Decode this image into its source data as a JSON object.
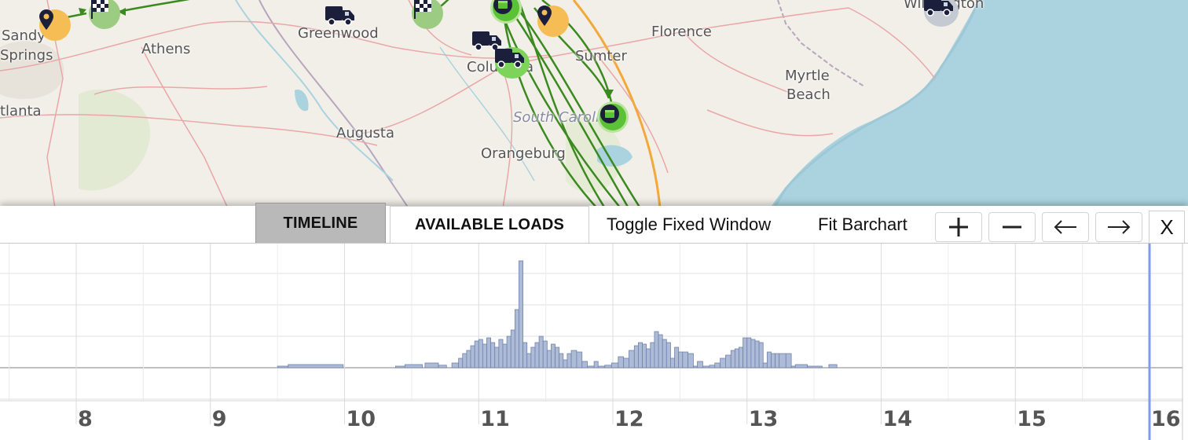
{
  "map": {
    "places": [
      {
        "name": "Sandy",
        "cls": "",
        "x": 2,
        "y": 36
      },
      {
        "name": "Springs",
        "cls": "",
        "x": 0,
        "y": 61
      },
      {
        "name": "Athens",
        "cls": "",
        "x": 180,
        "y": 53
      },
      {
        "name": "tlanta",
        "cls": "",
        "x": 0,
        "y": 132
      },
      {
        "name": "Greenwood",
        "cls": "",
        "x": 379,
        "y": 33
      },
      {
        "name": "Columbia",
        "cls": "",
        "x": 594,
        "y": 76
      },
      {
        "name": "Sumter",
        "cls": "",
        "x": 732,
        "y": 62
      },
      {
        "name": "Florence",
        "cls": "",
        "x": 829,
        "y": 31
      },
      {
        "name": "Myrtle",
        "cls": "",
        "x": 999,
        "y": 87
      },
      {
        "name": "Beach",
        "cls": "",
        "x": 1001,
        "y": 111
      },
      {
        "name": "Wilmington",
        "cls": "",
        "x": 1150,
        "y": -5
      },
      {
        "name": "Augusta",
        "cls": "",
        "x": 428,
        "y": 160
      },
      {
        "name": "Orangeburg",
        "cls": "",
        "x": 612,
        "y": 186
      },
      {
        "name": "South Carolina",
        "cls": "italic",
        "x": 653,
        "y": 140
      }
    ],
    "markers": [
      {
        "kind": "pin",
        "icon": "map-pin-icon",
        "x": 50,
        "y": 12
      },
      {
        "kind": "finish",
        "icon": "checkered-flag-icon",
        "x": 113,
        "y": -3
      },
      {
        "kind": "truck",
        "icon": "truck-icon",
        "x": 414,
        "y": 6
      },
      {
        "kind": "finish",
        "icon": "checkered-flag-icon",
        "x": 524,
        "y": -3
      },
      {
        "kind": "truck",
        "icon": "truck-icon",
        "x": 601,
        "y": 38
      },
      {
        "kind": "truck ringed",
        "icon": "truck-icon",
        "x": 630,
        "y": 60
      },
      {
        "kind": "load",
        "icon": "load-box-icon",
        "x": 624,
        "y": -10
      },
      {
        "kind": "pin",
        "icon": "map-pin-icon",
        "x": 684,
        "y": 7
      },
      {
        "kind": "load",
        "icon": "load-box-icon",
        "x": 760,
        "y": 129
      },
      {
        "kind": "truck gray",
        "icon": "truck-icon",
        "x": 1176,
        "y": -6
      }
    ],
    "colors": {
      "land": "#f2efe9",
      "water": "#aad3df",
      "route_green": "#3b8a1f",
      "route_orange": "#f2a93b",
      "roads": "#e9a7a7",
      "border": "#b7a6bd"
    }
  },
  "tabs": [
    {
      "label": "TIMELINE",
      "active": true
    },
    {
      "label": "AVAILABLE LOADS",
      "active": false
    }
  ],
  "toolbar": {
    "toggle_label": "Toggle Fixed Window",
    "fit_label": "Fit Barchart",
    "zoom_in_icon": "plus-icon",
    "zoom_out_icon": "minus-icon",
    "prev_icon": "arrow-left-icon",
    "next_icon": "arrow-right-icon",
    "close_label": "X"
  },
  "timeline": {
    "axis_ticks": [
      "8",
      "9",
      "10",
      "11",
      "12",
      "13",
      "14",
      "15",
      "16"
    ],
    "bar_color": "#aebbd6",
    "bar_edge": "#6f83ad",
    "cursor_color": "#7d9de8",
    "x_range": [
      7.5,
      16
    ],
    "bars": [
      [
        9.5,
        9.58,
        0.05
      ],
      [
        9.58,
        9.99,
        0.1
      ],
      [
        10.38,
        10.45,
        0.05
      ],
      [
        10.45,
        10.58,
        0.1
      ],
      [
        10.6,
        10.7,
        0.15
      ],
      [
        10.7,
        10.76,
        0.08
      ],
      [
        10.8,
        10.85,
        0.15
      ],
      [
        10.85,
        10.88,
        0.3
      ],
      [
        10.88,
        10.91,
        0.45
      ],
      [
        10.91,
        10.94,
        0.55
      ],
      [
        10.94,
        10.97,
        0.7
      ],
      [
        10.97,
        11.0,
        0.85
      ],
      [
        11.0,
        11.03,
        0.9
      ],
      [
        11.03,
        11.06,
        0.75
      ],
      [
        11.06,
        11.09,
        0.95
      ],
      [
        11.09,
        11.12,
        0.8
      ],
      [
        11.12,
        11.15,
        0.65
      ],
      [
        11.15,
        11.18,
        0.9
      ],
      [
        11.18,
        11.21,
        0.75
      ],
      [
        11.21,
        11.24,
        1.0
      ],
      [
        11.24,
        11.27,
        1.2
      ],
      [
        11.27,
        11.3,
        1.85
      ],
      [
        11.3,
        11.33,
        3.4
      ],
      [
        11.33,
        11.36,
        0.8
      ],
      [
        11.36,
        11.39,
        0.45
      ],
      [
        11.39,
        11.42,
        0.65
      ],
      [
        11.42,
        11.45,
        0.8
      ],
      [
        11.45,
        11.48,
        1.0
      ],
      [
        11.48,
        11.51,
        0.85
      ],
      [
        11.51,
        11.54,
        0.55
      ],
      [
        11.54,
        11.57,
        0.75
      ],
      [
        11.57,
        11.6,
        0.65
      ],
      [
        11.6,
        11.63,
        0.45
      ],
      [
        11.63,
        11.66,
        0.25
      ],
      [
        11.66,
        11.69,
        0.45
      ],
      [
        11.69,
        11.73,
        0.55
      ],
      [
        11.73,
        11.77,
        0.5
      ],
      [
        11.77,
        11.81,
        0.2
      ],
      [
        11.81,
        11.86,
        0.05
      ],
      [
        11.86,
        11.89,
        0.2
      ],
      [
        11.89,
        11.94,
        0.05
      ],
      [
        11.94,
        11.99,
        0.08
      ],
      [
        11.99,
        12.04,
        0.15
      ],
      [
        12.04,
        12.08,
        0.35
      ],
      [
        12.08,
        12.12,
        0.3
      ],
      [
        12.12,
        12.16,
        0.55
      ],
      [
        12.16,
        12.19,
        0.7
      ],
      [
        12.19,
        12.22,
        0.8
      ],
      [
        12.22,
        12.25,
        0.75
      ],
      [
        12.25,
        12.28,
        0.6
      ],
      [
        12.28,
        12.31,
        0.8
      ],
      [
        12.31,
        12.34,
        1.15
      ],
      [
        12.34,
        12.37,
        1.05
      ],
      [
        12.37,
        12.4,
        0.9
      ],
      [
        12.4,
        12.43,
        0.8
      ],
      [
        12.43,
        12.46,
        0.3
      ],
      [
        12.46,
        12.49,
        0.65
      ],
      [
        12.49,
        12.52,
        0.5
      ],
      [
        12.52,
        12.56,
        0.5
      ],
      [
        12.56,
        12.6,
        0.45
      ],
      [
        12.6,
        12.63,
        0.05
      ],
      [
        12.63,
        12.67,
        0.2
      ],
      [
        12.67,
        12.72,
        0.05
      ],
      [
        12.72,
        12.76,
        0.08
      ],
      [
        12.76,
        12.8,
        0.15
      ],
      [
        12.8,
        12.84,
        0.3
      ],
      [
        12.84,
        12.88,
        0.4
      ],
      [
        12.88,
        12.91,
        0.55
      ],
      [
        12.91,
        12.94,
        0.6
      ],
      [
        12.94,
        12.97,
        0.65
      ],
      [
        12.97,
        13.0,
        0.95
      ],
      [
        13.0,
        13.03,
        0.95
      ],
      [
        13.03,
        13.06,
        0.9
      ],
      [
        13.06,
        13.09,
        0.85
      ],
      [
        13.09,
        13.12,
        0.8
      ],
      [
        13.12,
        13.15,
        0.15
      ],
      [
        13.15,
        13.18,
        0.5
      ],
      [
        13.18,
        13.21,
        0.45
      ],
      [
        13.21,
        13.24,
        0.45
      ],
      [
        13.24,
        13.29,
        0.45
      ],
      [
        13.29,
        13.33,
        0.45
      ],
      [
        13.33,
        13.36,
        0.05
      ],
      [
        13.36,
        13.45,
        0.1
      ],
      [
        13.45,
        13.56,
        0.05
      ],
      [
        13.61,
        13.67,
        0.1
      ]
    ]
  }
}
